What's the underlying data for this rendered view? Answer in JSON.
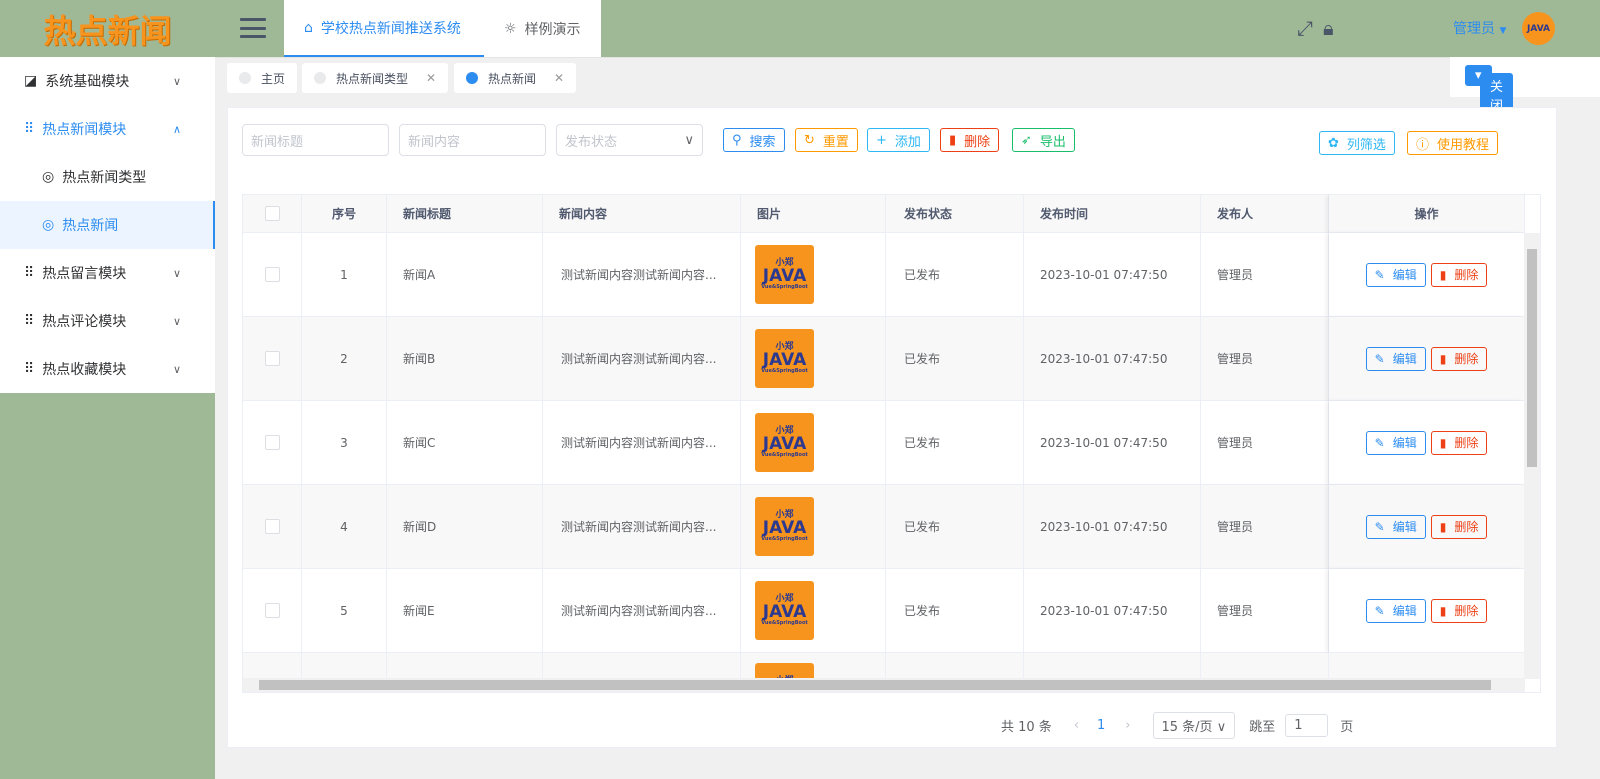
{
  "app": {
    "logo": "热点新闻",
    "user": "管理员",
    "avatar_text": "JAVA"
  },
  "nav": [
    {
      "label": "学校热点新闻推送系统",
      "icon": "home-icon"
    },
    {
      "label": "样例演示",
      "icon": "bulb-icon"
    }
  ],
  "sidebar": {
    "items": [
      {
        "label": "系统基础模块",
        "icon": "chart-icon"
      },
      {
        "label": "热点新闻模块",
        "icon": "grid-icon",
        "children": [
          {
            "label": "热点新闻类型"
          },
          {
            "label": "热点新闻"
          }
        ]
      },
      {
        "label": "热点留言模块",
        "icon": "grid-icon"
      },
      {
        "label": "热点评论模块",
        "icon": "grid-icon"
      },
      {
        "label": "热点收藏模块",
        "icon": "grid-icon"
      }
    ]
  },
  "tags": [
    {
      "label": "主页"
    },
    {
      "label": "热点新闻类型"
    },
    {
      "label": "热点新闻"
    }
  ],
  "close_menu": "关闭菜单",
  "filters": {
    "title_placeholder": "新闻标题",
    "content_placeholder": "新闻内容",
    "status_placeholder": "发布状态"
  },
  "toolbar": {
    "search": "搜索",
    "reset": "重置",
    "add": "添加",
    "delete": "删除",
    "export": "导出",
    "columns": "列筛选",
    "tutorial": "使用教程"
  },
  "colors": {
    "primary": "#2d8cf0",
    "warning": "#ff9900",
    "info": "#19be6b",
    "danger": "#ed4014",
    "sidebar_bg": "#9fb896"
  },
  "table": {
    "headers": [
      "序号",
      "新闻标题",
      "新闻内容",
      "图片",
      "发布状态",
      "发布时间",
      "发布人",
      "操作"
    ],
    "image_text": {
      "top": "小郑",
      "main": "JAVA",
      "bottom": "Vue&SpringBoot"
    },
    "edit": "编辑",
    "delete": "删除",
    "rows": [
      {
        "index": "1",
        "title": "新闻A",
        "content": "测试新闻内容测试新闻内容...",
        "status": "已发布",
        "time": "2023-10-01 07:47:50",
        "publisher": "管理员"
      },
      {
        "index": "2",
        "title": "新闻B",
        "content": "测试新闻内容测试新闻内容...",
        "status": "已发布",
        "time": "2023-10-01 07:47:50",
        "publisher": "管理员"
      },
      {
        "index": "3",
        "title": "新闻C",
        "content": "测试新闻内容测试新闻内容...",
        "status": "已发布",
        "time": "2023-10-01 07:47:50",
        "publisher": "管理员"
      },
      {
        "index": "4",
        "title": "新闻D",
        "content": "测试新闻内容测试新闻内容...",
        "status": "已发布",
        "time": "2023-10-01 07:47:50",
        "publisher": "管理员"
      },
      {
        "index": "5",
        "title": "新闻E",
        "content": "测试新闻内容测试新闻内容...",
        "status": "已发布",
        "time": "2023-10-01 07:47:50",
        "publisher": "管理员"
      }
    ]
  },
  "pagination": {
    "total": "共 10 条",
    "current": "1",
    "page_size": "15 条/页",
    "goto_label": "跳至",
    "goto_value": "1",
    "page_suffix": "页"
  }
}
